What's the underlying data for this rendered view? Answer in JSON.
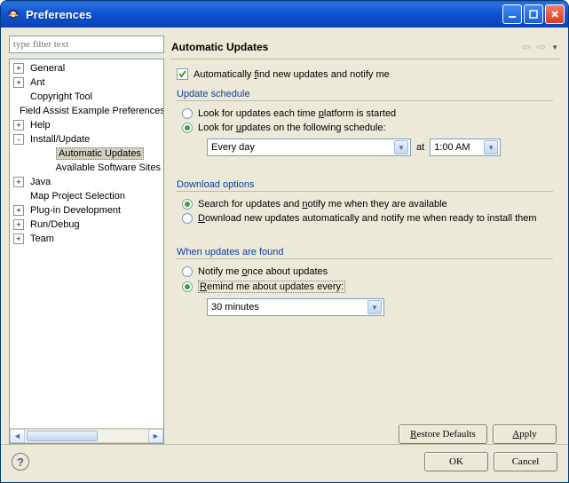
{
  "window": {
    "title": "Preferences"
  },
  "filter": {
    "placeholder": "type filter text"
  },
  "tree": [
    {
      "expand": "+",
      "depth": 0,
      "label": "General"
    },
    {
      "expand": "+",
      "depth": 0,
      "label": "Ant"
    },
    {
      "expand": "",
      "depth": 0,
      "label": "Copyright Tool"
    },
    {
      "expand": "",
      "depth": 0,
      "label": "Field Assist Example Preferences"
    },
    {
      "expand": "+",
      "depth": 0,
      "label": "Help"
    },
    {
      "expand": "-",
      "depth": 0,
      "label": "Install/Update"
    },
    {
      "expand": "",
      "depth": 1,
      "label": "Automatic Updates",
      "selected": true
    },
    {
      "expand": "",
      "depth": 1,
      "label": "Available Software Sites"
    },
    {
      "expand": "+",
      "depth": 0,
      "label": "Java"
    },
    {
      "expand": "",
      "depth": 0,
      "label": "Map Project Selection"
    },
    {
      "expand": "+",
      "depth": 0,
      "label": "Plug-in Development"
    },
    {
      "expand": "+",
      "depth": 0,
      "label": "Run/Debug"
    },
    {
      "expand": "+",
      "depth": 0,
      "label": "Team"
    }
  ],
  "page": {
    "title": "Automatic Updates",
    "auto_find_label": "Automatically find new updates and notify me",
    "auto_find_checked": true,
    "schedule": {
      "title": "Update schedule",
      "opt_startup": "Look for updates each time platform is started",
      "opt_schedule": "Look for updates on the following schedule:",
      "selected": "schedule",
      "day_value": "Every day",
      "at_label": "at",
      "time_value": "1:00 AM"
    },
    "download": {
      "title": "Download options",
      "opt_search": "Search for updates and notify me when they are available",
      "opt_auto": "Download new updates automatically and notify me when ready to install them",
      "selected": "search"
    },
    "found": {
      "title": "When updates are found",
      "opt_once": "Notify me once about updates",
      "opt_remind": "Remind me about updates every:",
      "selected": "remind",
      "remind_value": "30 minutes"
    }
  },
  "buttons": {
    "restore": "Restore Defaults",
    "apply": "Apply",
    "ok": "OK",
    "cancel": "Cancel"
  }
}
